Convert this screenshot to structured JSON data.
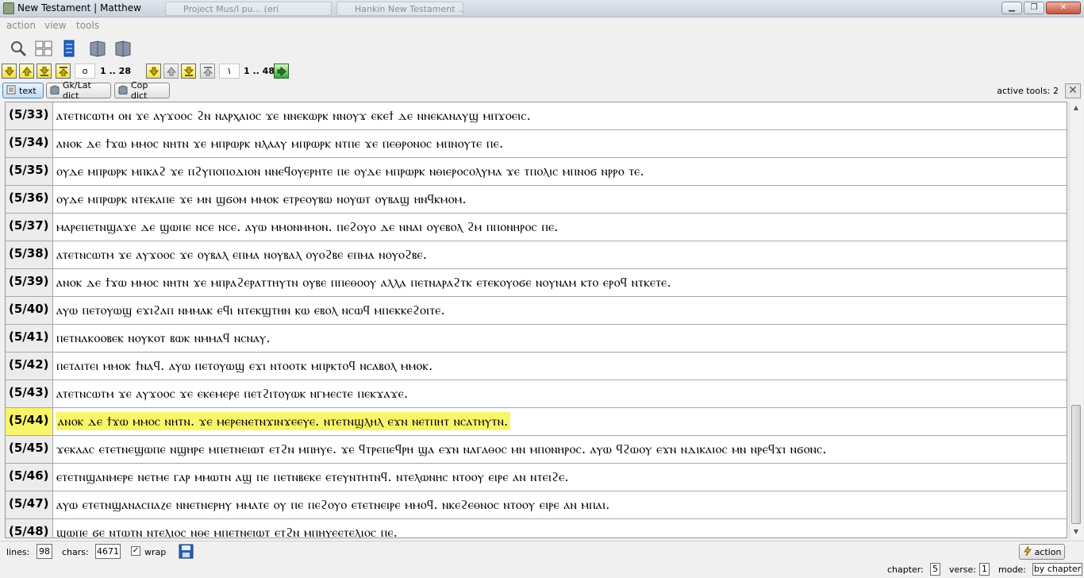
{
  "window": {
    "title": "New Testament | Matthew",
    "ghost_tabs": [
      "Project Mus/l pu... (eri",
      "Hankin New Testament ..."
    ]
  },
  "menu": {
    "items": [
      "action",
      "view",
      "tools"
    ]
  },
  "toolbar": {
    "icons": [
      "search-icon",
      "layout-icon",
      "column-icon",
      "book-icon",
      "book-icon"
    ]
  },
  "nav": {
    "chapter_value": "o",
    "chapter_range": "1 .. 28",
    "verse_value": "١",
    "verse_range": "1 .. 48"
  },
  "tabs": {
    "text": "text",
    "gklat": "Gk/Lat dict",
    "cop": "Cop dict",
    "active_tools": "active tools:  2"
  },
  "verses": [
    {
      "ref": "(5/33)",
      "text": "ⲁⲧⲉⲧⲛⲥⲱⲧⲙ ⲟⲛ ϫⲉ ⲁⲩϫⲟⲟⲥ ϩⲛ ⲛⲁⲣⲭⲁⲓⲟⲥ ϫⲉ ⲛⲛⲉⲕⲱⲣⲕ ⲛⲛⲟⲩϫ ⲉⲕⲉϯ ⲇⲉ ⲛⲛⲉⲕⲁⲛⲁⲩϣ ⲙⲡϫⲟⲉⲓⲥ."
    },
    {
      "ref": "(5/34)",
      "text": "ⲁⲛⲟⲕ ⲇⲉ ϯϫⲱ ⲙⲙⲟⲥ ⲛⲏⲧⲛ ϫⲉ ⲙⲡⲣⲱⲣⲕ ⲛⲗⲁⲁⲩ ⲙⲡⲣⲱⲣⲕ ⲛⲧⲡⲉ ϫⲉ ⲡⲉⲑⲣⲟⲛⲟⲥ ⲙⲡⲛⲟⲩⲧⲉ ⲡⲉ."
    },
    {
      "ref": "(5/35)",
      "text": "ⲟⲩⲇⲉ ⲙⲡⲣⲱⲣⲕ ⲙⲡⲕⲁϩ ϫⲉ ⲡϩⲩⲡⲟⲡⲟⲇⲓⲟⲛ ⲛⲛⲉϥⲟⲩⲉⲣⲏⲧⲉ ⲡⲉ ⲟⲩⲇⲉ ⲙⲡⲣⲱⲣⲕ ⲛⲑⲓⲉⲣⲟⲥⲟⲗⲩⲙⲁ ϫⲉ ⲧⲡⲟⲗⲓⲥ ⲙⲡⲛⲟϭ ⲛⲣⲣⲟ ⲧⲉ."
    },
    {
      "ref": "(5/36)",
      "text": "ⲟⲩⲇⲉ ⲙⲡⲣⲱⲣⲕ ⲛⲧⲉⲕⲁⲡⲉ ϫⲉ ⲙⲛ ϣϭⲟⲙ ⲙⲙⲟⲕ ⲉⲧⲣⲉⲟⲩⲃⲱ ⲛⲟⲩⲱⲧ ⲟⲩⲃⲁϣ ⲏⲛϥⲕⲙⲟⲙ."
    },
    {
      "ref": "(5/37)",
      "text": "ⲙⲁⲣⲉⲡⲉⲧⲛϣⲁϫⲉ ⲇⲉ ϣⲱⲡⲉ ⲛⲥⲉ ⲛⲥⲉ. ⲁⲩⲱ ⲙⲙⲟⲛⲙⲙⲟⲛ. ⲡⲉϩⲟⲩⲟ ⲇⲉ ⲛⲛⲁⲓ ⲟⲩⲉⲃⲟⲗ ϩⲙ ⲡⲡⲟⲛⲏⲣⲟⲥ ⲡⲉ."
    },
    {
      "ref": "(5/38)",
      "text": "ⲁⲧⲉⲧⲛⲥⲱⲧⲙ ϫⲉ ⲁⲩϫⲟⲟⲥ ϫⲉ ⲟⲩⲃⲁⲗ ⲉⲡⲙⲁ ⲛⲟⲩⲃⲁⲗ ⲟⲩⲟϩⲃⲉ ⲉⲡⲙⲁ ⲛⲟⲩⲟϩⲃⲉ."
    },
    {
      "ref": "(5/39)",
      "text": "ⲁⲛⲟⲕ ⲇⲉ ϯϫⲱ ⲙⲙⲟⲥ ⲛⲏⲧⲛ ϫⲉ ⲙⲡⲣⲁϩⲉⲣⲁⲧⲧⲏⲩⲧⲛ ⲟⲩⲃⲉ ⲡⲡⲉⲑⲟⲟⲩ ⲁⲗⲗⲁ ⲡⲉⲧⲛⲁⲣⲁϩⲧⲕ ⲉⲧⲉⲕⲟⲩⲟϭⲉ ⲛⲟⲩⲛⲁⲙ ⲕⲧⲟ ⲉⲣⲟϥ ⲛⲧⲕⲉⲧⲉ."
    },
    {
      "ref": "(5/40)",
      "text": "ⲁⲩⲱ ⲡⲉⲧⲟⲩⲱϣ ⲉϫⲓϩⲁⲡ ⲛⲙⲙⲁⲕ ⲉϥⲓ ⲛⲧⲉⲕϣⲧⲏⲛ ⲕⲱ ⲉⲃⲟⲗ ⲛⲥⲱϥ ⲙⲡⲉⲕⲕⲉϩⲟⲓⲧⲉ."
    },
    {
      "ref": "(5/41)",
      "text": "ⲡⲉⲧⲛⲁⲕⲟⲟⲃⲉⲕ ⲛⲟⲩⲕⲟⲧ ⲃⲱⲕ ⲛⲙⲙⲁϥ ⲛⲥⲛⲁⲩ."
    },
    {
      "ref": "(5/42)",
      "text": "ⲡⲉⲧⲁⲓⲧⲉⲓ ⲙⲙⲟⲕ ϯⲛⲁϥ. ⲁⲩⲱ ⲡⲉⲧⲟⲩⲱϣ ⲉϫⲓ ⲛⲧⲟⲟⲧⲕ ⲙⲡⲣⲕⲧⲟϥ ⲛⲥⲁⲃⲟⲗ ⲙⲙⲟⲕ."
    },
    {
      "ref": "(5/43)",
      "text": "ⲁⲧⲉⲧⲛⲥⲱⲧⲙ ϫⲉ ⲁⲩϫⲟⲟⲥ ϫⲉ ⲉⲕⲉⲙⲉⲣⲉ ⲡⲉⲧϩⲓⲧⲟⲩⲱⲕ ⲛⲅⲙⲉⲥⲧⲉ ⲡⲉⲕϫⲁϫⲉ."
    },
    {
      "ref": "(5/44)",
      "text": "ⲁⲛⲟⲕ ⲇⲉ ϯϫⲱ ⲙⲙⲟⲥ ⲛⲏⲧⲛ. ϫⲉ ⲙⲉⲣⲉⲛⲉⲧⲛϫⲓⲛϫⲉⲉⲩⲉ. ⲛⲧⲉⲧⲛϣⲗⲏⲗ ⲉϫⲛ ⲛⲉⲧⲡⲏⲧ ⲛⲥⲁⲧⲏⲩⲧⲛ.",
      "highlight": true
    },
    {
      "ref": "(5/45)",
      "text": "ϫⲉⲕⲁⲁⲥ ⲉⲧⲉⲧⲛⲉϣⲱⲡⲉ ⲛϣⲏⲣⲉ ⲙⲡⲉⲧⲛⲉⲓⲱⲧ ⲉⲧϩⲛ ⲙⲡⲏⲩⲉ. ϫⲉ ϥⲧⲣⲉⲡⲉϥⲣⲏ ϣⲁ ⲉϫⲛ ⲛⲁⲅⲁⲑⲟⲥ ⲙⲛ ⲙⲡⲟⲛⲏⲣⲟⲥ. ⲁⲩⲱ ϥϩⲱⲟⲩ ⲉϫⲛ ⲛⲇⲓⲕⲁⲓⲟⲥ ⲙⲛ ⲛⲣⲉϥϫⲓ ⲛϭⲟⲛⲥ."
    },
    {
      "ref": "(5/46)",
      "text": "ⲉⲧⲉⲧⲛϣⲁⲛⲙⲉⲣⲉ ⲛⲉⲧⲙⲉ ⲅⲁⲣ ⲙⲙⲱⲧⲛ ⲁϣ ⲡⲉ ⲡⲉⲧⲛⲃⲉⲕⲉ ⲉⲧⲉⲩⲛⲧⲏⲧⲛϥ. ⲛⲧⲉⲗⲱⲛⲏⲥ ⲛⲧⲟⲟⲩ ⲉⲓⲣⲉ ⲁⲛ ⲛⲧⲉⲓϩⲉ."
    },
    {
      "ref": "(5/47)",
      "text": "ⲁⲩⲱ ⲉⲧⲉⲧⲛϣⲁⲛⲁⲥⲡⲁⲍⲉ ⲛⲛⲉⲧⲛⲉⲣⲏⲩ ⲙⲙⲁⲧⲉ ⲟⲩ ⲡⲉ ⲡⲉϩⲟⲩⲟ ⲉⲧⲉⲧⲛⲉⲓⲣⲉ ⲙⲙⲟϥ. ⲛⲕⲉϩⲉⲑⲛⲟⲥ ⲛⲧⲟⲟⲩ ⲉⲓⲣⲉ ⲁⲛ ⲙⲡⲁⲓ."
    },
    {
      "ref": "(5/48)",
      "text": "ϣⲱⲡⲉ ϭⲉ ⲛⲧⲱⲧⲛ ⲛⲧⲉⲗⲓⲟⲥ ⲛⲑⲉ ⲙⲡⲉⲧⲛⲉⲓⲱⲧ ⲉⲧϩⲛ ⲙⲡⲏⲩⲉⲉⲧⲉⲗⲓⲟⲥ ⲡⲉ."
    }
  ],
  "status": {
    "lines_label": "lines:",
    "lines_value": "98",
    "chars_label": "chars:",
    "chars_value": "4671",
    "wrap_label": "wrap",
    "wrap_checked": "✓",
    "action_label": "action"
  },
  "bottom": {
    "chapter_label": "chapter:",
    "chapter_value": "5",
    "verse_label": "verse:",
    "verse_value": "1",
    "mode_label": "mode:",
    "mode_value": "by chapter"
  }
}
